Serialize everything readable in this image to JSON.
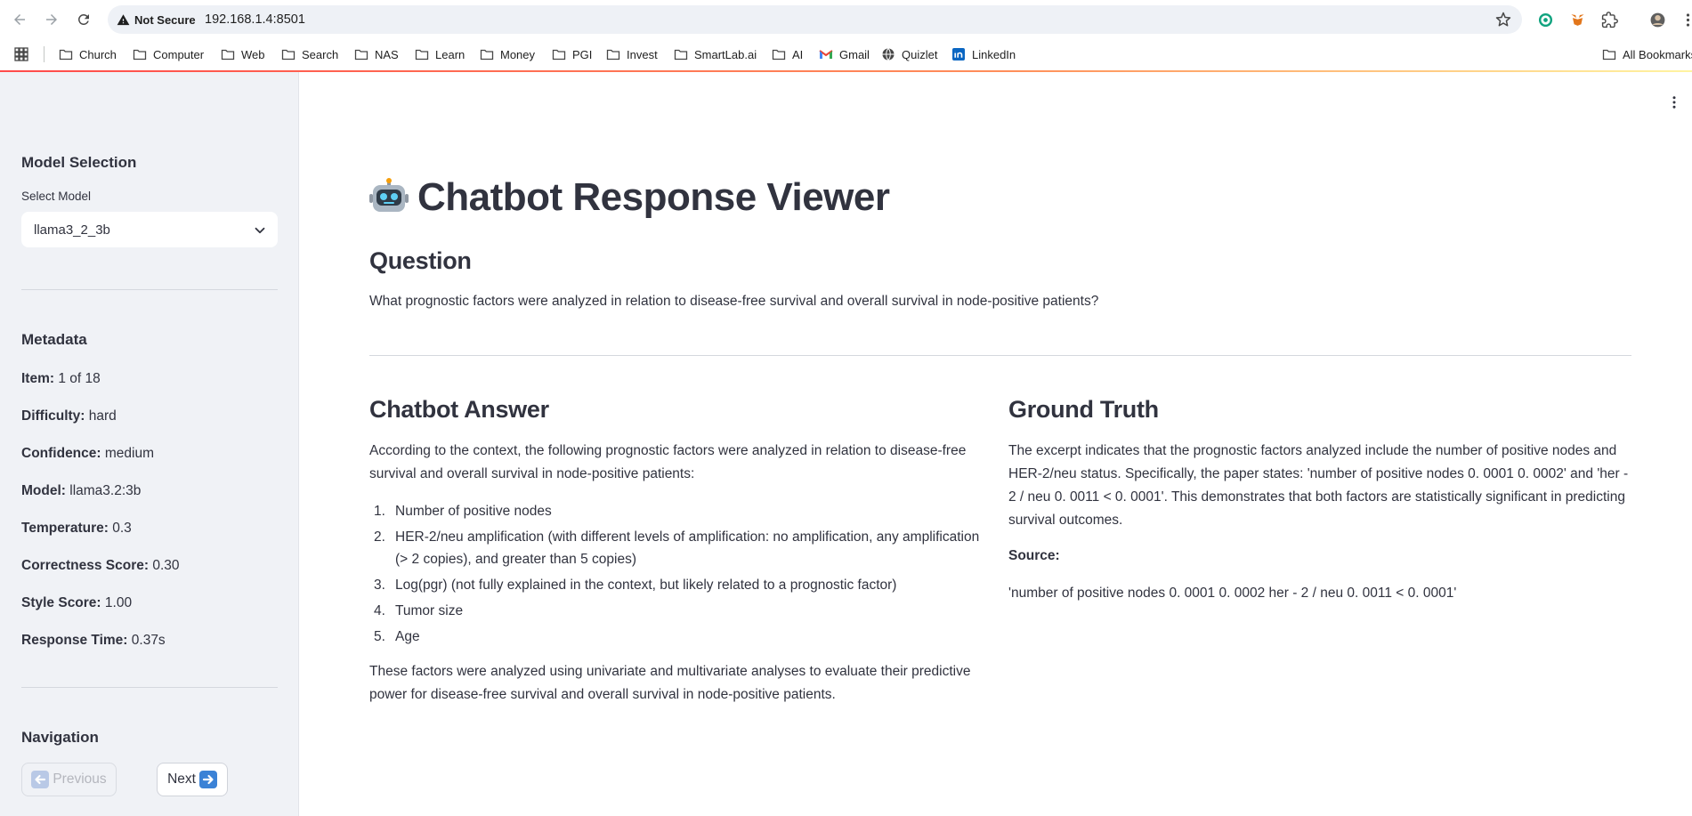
{
  "browser": {
    "security_label": "Not Secure",
    "url": "192.168.1.4:8501",
    "bookmarks": [
      {
        "label": "Church",
        "icon": "folder-icon"
      },
      {
        "label": "Computer",
        "icon": "folder-icon"
      },
      {
        "label": "Web",
        "icon": "folder-icon"
      },
      {
        "label": "Search",
        "icon": "folder-icon"
      },
      {
        "label": "NAS",
        "icon": "folder-icon"
      },
      {
        "label": "Learn",
        "icon": "folder-icon"
      },
      {
        "label": "Money",
        "icon": "folder-icon"
      },
      {
        "label": "PGI",
        "icon": "folder-icon"
      },
      {
        "label": "Invest",
        "icon": "folder-icon"
      },
      {
        "label": "SmartLab.ai",
        "icon": "folder-icon"
      },
      {
        "label": "AI",
        "icon": "folder-icon"
      },
      {
        "label": "Gmail",
        "icon": "gmail-icon"
      },
      {
        "label": "Quizlet",
        "icon": "globe-icon"
      },
      {
        "label": "LinkedIn",
        "icon": "linkedin-icon"
      }
    ],
    "all_bookmarks_label": "All Bookmarks"
  },
  "sidebar": {
    "model_selection_heading": "Model Selection",
    "select_model_label": "Select Model",
    "selected_model": "llama3_2_3b",
    "metadata_heading": "Metadata",
    "metadata": [
      {
        "key": "Item:",
        "value": "1 of 18"
      },
      {
        "key": "Difficulty:",
        "value": "hard"
      },
      {
        "key": "Confidence:",
        "value": "medium"
      },
      {
        "key": "Model:",
        "value": "llama3.2:3b"
      },
      {
        "key": "Temperature:",
        "value": "0.3"
      },
      {
        "key": "Correctness Score:",
        "value": "0.30"
      },
      {
        "key": "Style Score:",
        "value": "1.00"
      },
      {
        "key": "Response Time:",
        "value": "0.37s"
      }
    ],
    "navigation_heading": "Navigation",
    "previous_label": "Previous",
    "next_label": "Next"
  },
  "main": {
    "title": "Chatbot Response Viewer",
    "question_heading": "Question",
    "question_text": "What prognostic factors were analyzed in relation to disease-free survival and overall survival in node-positive patients?",
    "answer_heading": "Chatbot Answer",
    "answer_intro": "According to the context, the following prognostic factors were analyzed in relation to disease-free survival and overall survival in node-positive patients:",
    "answer_items": [
      "Number of positive nodes",
      "HER-2/neu amplification (with different levels of amplification: no amplification, any amplification (> 2 copies), and greater than 5 copies)",
      "Log(pgr) (not fully explained in the context, but likely related to a prognostic factor)",
      "Tumor size",
      "Age"
    ],
    "answer_outro": "These factors were analyzed using univariate and multivariate analyses to evaluate their predictive power for disease-free survival and overall survival in node-positive patients.",
    "ground_truth_heading": "Ground Truth",
    "ground_truth_text": "The excerpt indicates that the prognostic factors analyzed include the number of positive nodes and HER-2/neu status. Specifically, the paper states: 'number of positive nodes 0. 0001 0. 0002' and 'her - 2 / neu 0. 0011 < 0. 0001'. This demonstrates that both factors are statistically significant in predicting survival outcomes.",
    "source_label": "Source:",
    "source_text": "'number of positive nodes 0. 0001 0. 0002 her - 2 / neu 0. 0011 < 0. 0001'"
  }
}
